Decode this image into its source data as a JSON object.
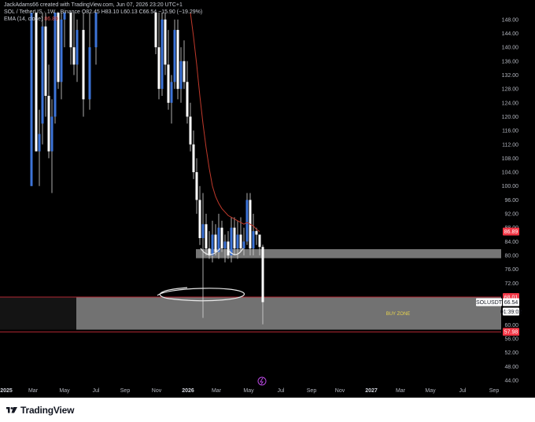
{
  "header": {
    "created_by": "JackAdams66 created with TradingView.com, Jun 07, 2026 23:20 UTC+1",
    "symbol_line": "SOL / TetherUS · 1W · Binance  O82.45  H83.10  L60.13  C66.54  −15.90 (−19.29%)",
    "ema_label": "EMA (14, close)",
    "ema_value": "86.89"
  },
  "footer": {
    "brand": "TradingView"
  },
  "chart_data": {
    "type": "candlestick",
    "title": "SOL / TetherUS · 1W · Binance",
    "ylim": [
      40,
      150
    ],
    "y_ticks": [
      44,
      48,
      52,
      56,
      60,
      64,
      68,
      72,
      76,
      80,
      84,
      88,
      92,
      96,
      100,
      104,
      108,
      112,
      116,
      120,
      124,
      128,
      132,
      136,
      140,
      144,
      148
    ],
    "x_ticks": [
      "2025",
      "Mar",
      "May",
      "Jul",
      "Sep",
      "Nov",
      "2026",
      "Mar",
      "May",
      "Jul",
      "Sep",
      "Nov",
      "2027",
      "Mar",
      "May",
      "Jul",
      "Sep"
    ],
    "price_labels": [
      {
        "text": "86.89",
        "value": 86.89,
        "color": "#f23645"
      },
      {
        "text": "68.01",
        "value": 68.01,
        "color": "#f23645"
      },
      {
        "text": "SOLUSDT",
        "value": 66.54,
        "color": "#ffffff"
      },
      {
        "text": "66.54",
        "value": 66.54,
        "color": "#ffffff"
      },
      {
        "text": "01:39:02",
        "value": 63.8,
        "color": "#ffffff"
      },
      {
        "text": "57.98",
        "value": 57.98,
        "color": "#f23645"
      }
    ],
    "zones": [
      {
        "label": "BUY ZONE",
        "low": 58.6,
        "high": 67.9,
        "color": "#9e9e9e"
      },
      {
        "label": "",
        "low": 79.2,
        "high": 81.8,
        "color": "#9e9e9e"
      }
    ],
    "hlines": [
      {
        "value": 68.01,
        "color": "#f23645"
      },
      {
        "value": 57.98,
        "color": "#f23645"
      }
    ],
    "candles": [
      [
        40,
        100,
        150,
        100,
        150
      ],
      [
        46,
        150,
        150,
        110,
        110
      ],
      [
        50,
        110,
        122,
        100,
        115
      ],
      [
        54,
        118,
        150,
        112,
        146
      ],
      [
        58,
        146,
        150,
        120,
        126
      ],
      [
        62,
        126,
        135,
        108,
        110
      ],
      [
        66,
        110,
        125,
        98,
        120
      ],
      [
        70,
        120,
        150,
        118,
        150
      ],
      [
        74,
        150,
        150,
        128,
        130
      ],
      [
        78,
        130,
        150,
        125,
        148
      ],
      [
        82,
        148,
        150,
        140,
        150
      ],
      [
        90,
        150,
        150,
        135,
        140
      ],
      [
        94,
        140,
        150,
        132,
        135
      ],
      [
        98,
        135,
        148,
        130,
        145
      ],
      [
        106,
        145,
        150,
        120,
        125
      ],
      [
        114,
        125,
        150,
        122,
        140
      ],
      [
        122,
        140,
        150,
        135,
        150
      ],
      [
        198,
        150,
        150,
        138,
        140
      ],
      [
        202,
        140,
        150,
        125,
        128
      ],
      [
        206,
        128,
        150,
        126,
        148
      ],
      [
        210,
        148,
        150,
        132,
        135
      ],
      [
        214,
        135,
        145,
        122,
        124
      ],
      [
        218,
        124,
        132,
        118,
        130
      ],
      [
        222,
        130,
        148,
        128,
        145
      ],
      [
        226,
        145,
        148,
        125,
        128
      ],
      [
        230,
        128,
        140,
        124,
        136
      ],
      [
        234,
        136,
        142,
        128,
        130
      ],
      [
        238,
        130,
        136,
        118,
        120
      ],
      [
        242,
        120,
        124,
        110,
        112
      ],
      [
        246,
        112,
        116,
        102,
        104
      ],
      [
        250,
        104,
        108,
        92,
        96
      ],
      [
        254,
        96,
        100,
        83,
        85
      ],
      [
        258,
        85,
        98,
        62,
        89
      ],
      [
        262,
        89,
        92,
        80,
        82
      ],
      [
        266,
        82,
        87,
        79,
        80
      ],
      [
        270,
        80,
        90,
        78,
        86
      ],
      [
        274,
        86,
        89,
        80,
        81
      ],
      [
        278,
        81,
        92,
        79,
        88
      ],
      [
        282,
        88,
        90,
        81,
        82
      ],
      [
        286,
        82,
        86,
        78,
        84
      ],
      [
        290,
        84,
        87,
        79,
        80
      ],
      [
        294,
        80,
        91,
        78,
        88
      ],
      [
        298,
        88,
        91,
        80,
        82
      ],
      [
        302,
        82,
        90,
        79,
        86
      ],
      [
        306,
        86,
        91,
        81,
        82
      ],
      [
        310,
        82,
        88,
        80,
        84
      ],
      [
        314,
        84,
        98,
        83,
        96
      ],
      [
        318,
        96,
        98,
        80,
        82
      ],
      [
        322,
        82,
        92,
        80,
        87
      ],
      [
        326,
        87,
        88,
        83,
        86
      ],
      [
        330,
        86,
        86,
        80,
        82.45
      ],
      [
        334,
        82.45,
        83.1,
        60.13,
        66.54
      ]
    ],
    "ema": [
      [
        242,
        150
      ],
      [
        246,
        143
      ],
      [
        250,
        135
      ],
      [
        254,
        126
      ],
      [
        258,
        118
      ],
      [
        262,
        111
      ],
      [
        266,
        105
      ],
      [
        270,
        100
      ],
      [
        274,
        97
      ],
      [
        278,
        95
      ],
      [
        282,
        93.5
      ],
      [
        286,
        92.5
      ],
      [
        290,
        91.5
      ],
      [
        294,
        91
      ],
      [
        298,
        90.5
      ],
      [
        302,
        90
      ],
      [
        306,
        89.5
      ],
      [
        310,
        89
      ],
      [
        314,
        89.5
      ],
      [
        318,
        89
      ],
      [
        322,
        88.5
      ],
      [
        326,
        87.5
      ],
      [
        330,
        86.89
      ]
    ]
  }
}
